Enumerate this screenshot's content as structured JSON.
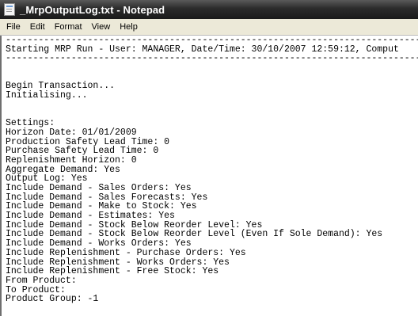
{
  "window": {
    "title": "_MrpOutputLog.txt - Notepad",
    "icon": "notepad-icon"
  },
  "menu": {
    "items": [
      "File",
      "Edit",
      "Format",
      "View",
      "Help"
    ]
  },
  "document": {
    "lines": [
      "------------------------------------------------------------------------------------------------------",
      "Starting MRP Run - User: MANAGER, Date/Time: 30/10/2007 12:59:12, Comput",
      "------------------------------------------------------------------------------------------------------",
      "",
      "",
      "Begin Transaction...",
      "Initialising...",
      "",
      "",
      "Settings:",
      "Horizon Date: 01/01/2009",
      "Production Safety Lead Time: 0",
      "Purchase Safety Lead Time: 0",
      "Replenishment Horizon: 0",
      "Aggregate Demand: Yes",
      "Output Log: Yes",
      "Include Demand - Sales Orders: Yes",
      "Include Demand - Sales Forecasts: Yes",
      "Include Demand - Make to Stock: Yes",
      "Include Demand - Estimates: Yes",
      "Include Demand - Stock Below Reorder Level: Yes",
      "Include Demand - Stock Below Reorder Level (Even If Sole Demand): Yes",
      "Include Demand - Works Orders: Yes",
      "Include Replenishment - Purchase Orders: Yes",
      "Include Replenishment - Works Orders: Yes",
      "Include Replenishment - Free Stock: Yes",
      "From Product:",
      "To Product:",
      "Product Group: -1"
    ]
  }
}
